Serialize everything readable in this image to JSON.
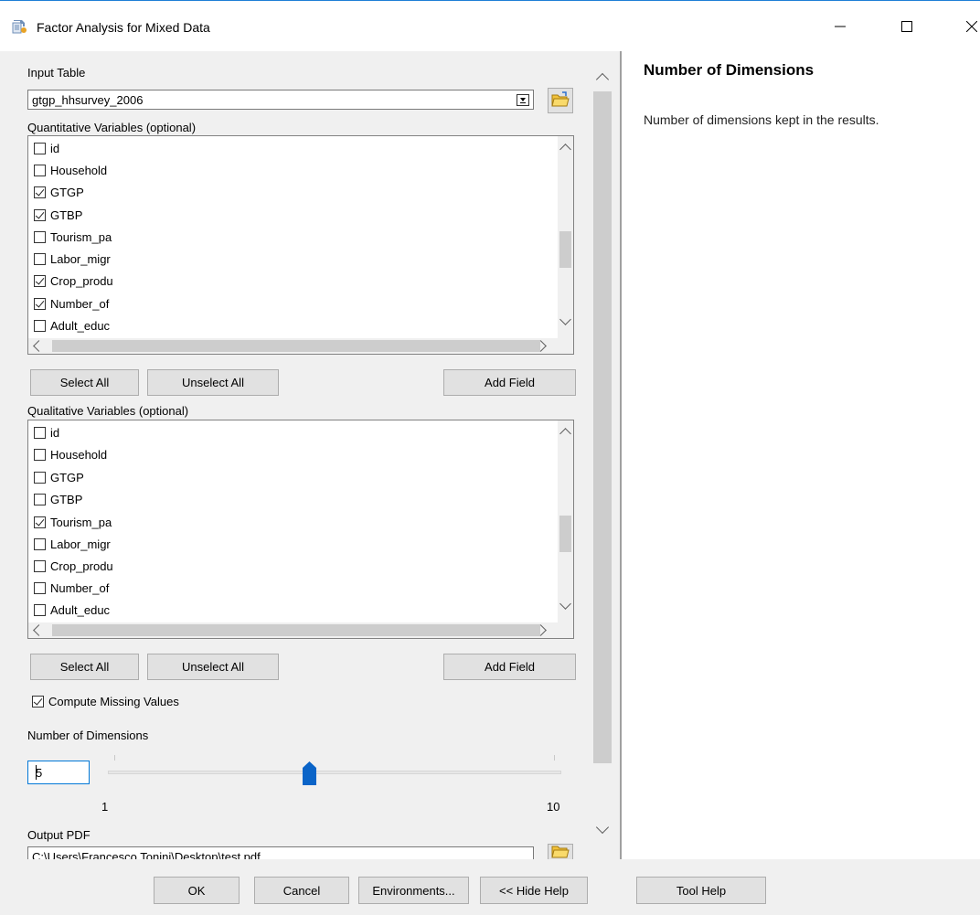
{
  "window": {
    "title": "Factor Analysis for Mixed Data"
  },
  "input_table": {
    "label": "Input Table",
    "value": "gtgp_hhsurvey_2006"
  },
  "quantitative": {
    "label": "Quantitative Variables (optional)",
    "items": [
      {
        "label": "id",
        "checked": false
      },
      {
        "label": "Household",
        "checked": false
      },
      {
        "label": "GTGP",
        "checked": true
      },
      {
        "label": "GTBP",
        "checked": true
      },
      {
        "label": "Tourism_pa",
        "checked": false
      },
      {
        "label": "Labor_migr",
        "checked": false
      },
      {
        "label": "Crop_produ",
        "checked": true
      },
      {
        "label": "Number_of",
        "checked": true
      },
      {
        "label": "Adult_educ",
        "checked": false
      }
    ],
    "select_all": "Select All",
    "unselect_all": "Unselect All",
    "add_field": "Add Field"
  },
  "qualitative": {
    "label": "Qualitative Variables (optional)",
    "items": [
      {
        "label": "id",
        "checked": false
      },
      {
        "label": "Household",
        "checked": false
      },
      {
        "label": "GTGP",
        "checked": false
      },
      {
        "label": "GTBP",
        "checked": false
      },
      {
        "label": "Tourism_pa",
        "checked": true
      },
      {
        "label": "Labor_migr",
        "checked": false
      },
      {
        "label": "Crop_produ",
        "checked": false
      },
      {
        "label": "Number_of",
        "checked": false
      },
      {
        "label": "Adult_educ",
        "checked": false
      }
    ],
    "select_all": "Select All",
    "unselect_all": "Unselect All",
    "add_field": "Add Field"
  },
  "compute_missing": {
    "label": "Compute Missing Values",
    "checked": true
  },
  "dimensions": {
    "label": "Number of Dimensions",
    "value": "5",
    "min": "1",
    "max": "10",
    "slider_value": 5
  },
  "output_pdf": {
    "label": "Output PDF",
    "value": "C:\\Users\\Francesco Tonini\\Desktop\\test.pdf"
  },
  "help": {
    "title": "Number of Dimensions",
    "body": "Number of dimensions kept in the results."
  },
  "footer": {
    "ok": "OK",
    "cancel": "Cancel",
    "environments": "Environments...",
    "hide_help": "<< Hide Help",
    "tool_help": "Tool Help"
  },
  "colors": {
    "accent": "#0078d7",
    "slider_thumb": "#0a64c8",
    "title_border": "#1e7fd6"
  }
}
